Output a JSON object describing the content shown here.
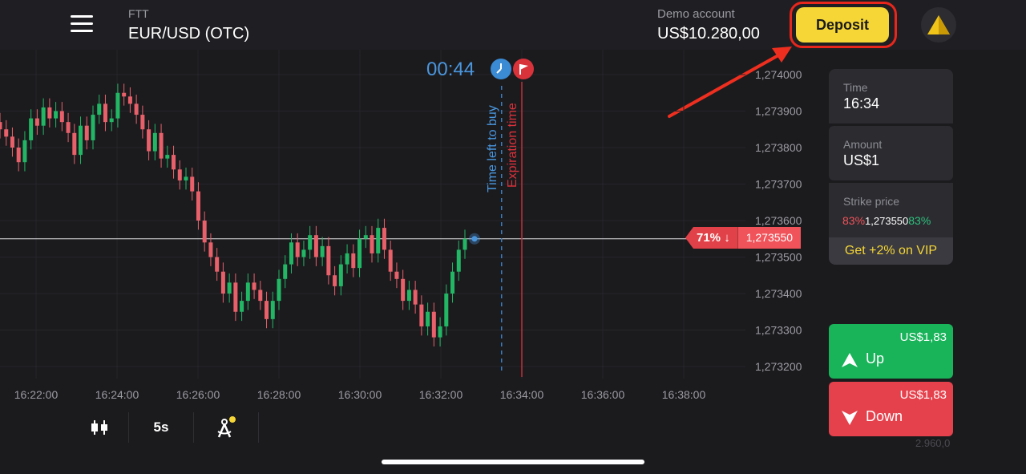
{
  "header": {
    "asset_type": "FTT",
    "asset_name": "EUR/USD (OTC)",
    "account_label": "Demo account",
    "balance": "US$10.280,00",
    "deposit_label": "Deposit"
  },
  "chart": {
    "countdown": "00:44",
    "buy_label": "Time left to buy",
    "expiration_label": "Expiration time",
    "current_pct": "71%",
    "current_arrow": "↓",
    "current_price": "1,273550"
  },
  "side": {
    "time_label": "Time",
    "time_value": "16:34",
    "amount_label": "Amount",
    "amount_value": "US$1",
    "strike_label": "Strike price",
    "strike_left_pct": "83%",
    "strike_value": "1,273550",
    "strike_right_pct": "83%",
    "vip_label": "Get +2% on VIP",
    "up_payout": "US$1,83",
    "up_label": "Up",
    "down_payout": "US$1,83",
    "down_label": "Down",
    "faint_value": "2.960,0"
  },
  "toolbar": {
    "interval": "5s"
  },
  "colors": {
    "up": "#19b35a",
    "down": "#e5414c",
    "accent": "#f5d636",
    "timer": "#4a96dd"
  },
  "chart_data": {
    "type": "candlestick",
    "x_ticks": [
      "16:22:00",
      "16:24:00",
      "16:26:00",
      "16:28:00",
      "16:30:00",
      "16:32:00",
      "16:34:00",
      "16:36:00",
      "16:38:00"
    ],
    "y_ticks": [
      "1,274000",
      "1,273900",
      "1,273800",
      "1,273700",
      "1,273600",
      "1,273500",
      "1,273400",
      "1,273300",
      "1,273200"
    ],
    "ylim": [
      1.27318,
      1.27402
    ],
    "xlim_minutes": [
      0,
      17.7
    ],
    "current_price": 1.27355,
    "buy_deadline_min": 11.5,
    "expiration_min": 12.0,
    "closes": [
      1.27385,
      1.27383,
      1.2738,
      1.27376,
      1.27382,
      1.27388,
      1.27386,
      1.27391,
      1.27388,
      1.2739,
      1.27387,
      1.27384,
      1.27378,
      1.27386,
      1.27382,
      1.27389,
      1.27392,
      1.27387,
      1.27388,
      1.27395,
      1.27394,
      1.27392,
      1.27389,
      1.27385,
      1.27379,
      1.27384,
      1.27377,
      1.27378,
      1.27374,
      1.27371,
      1.27372,
      1.27368,
      1.2736,
      1.27354,
      1.2735,
      1.27346,
      1.2734,
      1.27343,
      1.27335,
      1.27338,
      1.27343,
      1.27341,
      1.27338,
      1.27333,
      1.27338,
      1.27344,
      1.27348,
      1.27354,
      1.2735,
      1.27352,
      1.27356,
      1.2735,
      1.27353,
      1.27345,
      1.27342,
      1.27348,
      1.27351,
      1.27347,
      1.27355,
      1.27356,
      1.27351,
      1.27358,
      1.27352,
      1.27346,
      1.27344,
      1.27338,
      1.27341,
      1.27337,
      1.27331,
      1.27335,
      1.27328,
      1.27331,
      1.2734,
      1.27346,
      1.27352,
      1.27355
    ]
  }
}
